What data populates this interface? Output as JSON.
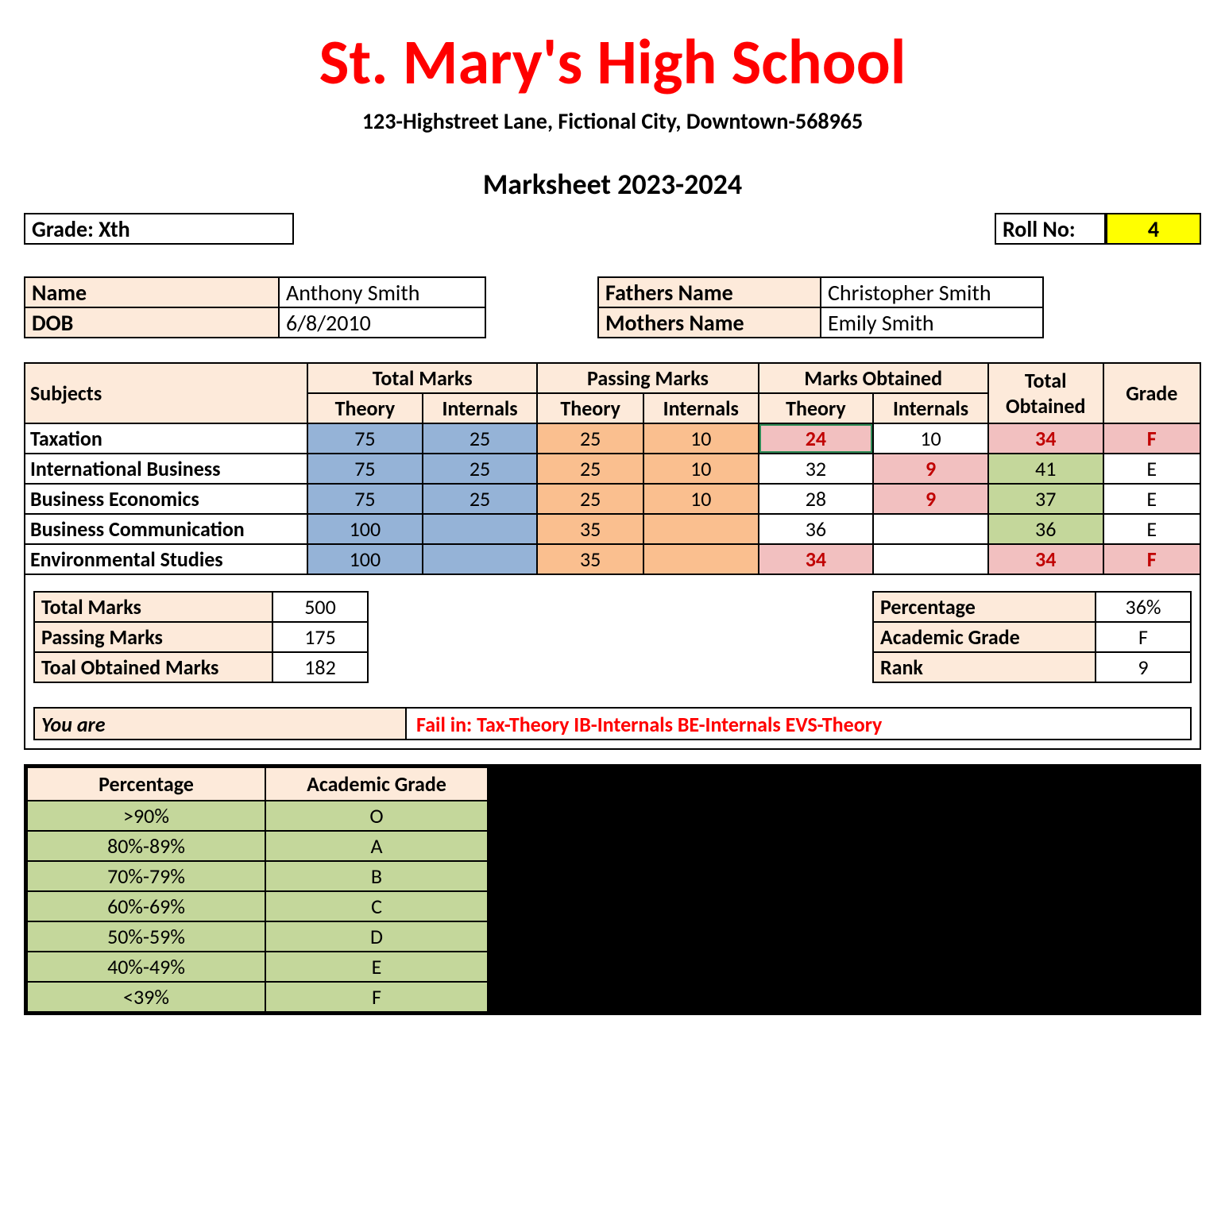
{
  "header": {
    "school": "St. Mary's High School",
    "address": "123-Highstreet Lane, Fictional City, Downtown-568965",
    "title": "Marksheet 2023-2024"
  },
  "top": {
    "grade_label": "Grade: Xth",
    "roll_label": "Roll No:",
    "roll_value": "4"
  },
  "student": {
    "name_label": "Name",
    "name": "Anthony Smith",
    "dob_label": "DOB",
    "dob": "6/8/2010",
    "father_label": "Fathers Name",
    "father": "Christopher Smith",
    "mother_label": "Mothers Name",
    "mother": "Emily Smith"
  },
  "marks_header": {
    "subjects": "Subjects",
    "total_marks": "Total Marks",
    "passing_marks": "Passing Marks",
    "marks_obtained": "Marks Obtained",
    "total_obtained": "Total Obtained",
    "grade": "Grade",
    "theory": "Theory",
    "internals": "Internals"
  },
  "subjects": [
    {
      "name": "Taxation",
      "tm_t": "75",
      "tm_i": "25",
      "pm_t": "25",
      "pm_i": "10",
      "mo_t": "24",
      "mo_i": "10",
      "tot": "34",
      "grade": "F",
      "mo_t_fail": true,
      "mo_i_fail": false,
      "tot_green": false,
      "grade_fail": true,
      "sel": true
    },
    {
      "name": "International Business",
      "tm_t": "75",
      "tm_i": "25",
      "pm_t": "25",
      "pm_i": "10",
      "mo_t": "32",
      "mo_i": "9",
      "tot": "41",
      "grade": "E",
      "mo_t_fail": false,
      "mo_i_fail": true,
      "tot_green": true,
      "grade_fail": false
    },
    {
      "name": "Business Economics",
      "tm_t": "75",
      "tm_i": "25",
      "pm_t": "25",
      "pm_i": "10",
      "mo_t": "28",
      "mo_i": "9",
      "tot": "37",
      "grade": "E",
      "mo_t_fail": false,
      "mo_i_fail": true,
      "tot_green": true,
      "grade_fail": false
    },
    {
      "name": "Business Communication",
      "tm_t": "100",
      "tm_i": "",
      "pm_t": "35",
      "pm_i": "",
      "mo_t": "36",
      "mo_i": "",
      "tot": "36",
      "grade": "E",
      "mo_t_fail": false,
      "mo_i_fail": false,
      "tot_green": true,
      "grade_fail": false
    },
    {
      "name": "Environmental Studies",
      "tm_t": "100",
      "tm_i": "",
      "pm_t": "35",
      "pm_i": "",
      "mo_t": "34",
      "mo_i": "",
      "tot": "34",
      "grade": "F",
      "mo_t_fail": true,
      "mo_i_fail": false,
      "tot_green": false,
      "grade_fail": true
    }
  ],
  "summary_left": {
    "total_marks_label": "Total Marks",
    "total_marks": "500",
    "passing_marks_label": "Passing Marks",
    "passing_marks": "175",
    "obtained_label": "Toal Obtained Marks",
    "obtained": "182"
  },
  "summary_right": {
    "pct_label": "Percentage",
    "pct": "36%",
    "grade_label": "Academic  Grade",
    "grade": "F",
    "rank_label": "Rank",
    "rank": "9"
  },
  "youare": {
    "label": "You are",
    "value": "Fail in: Tax-Theory   IB-Internals  BE-Internals  EVS-Theory"
  },
  "legend": {
    "h1": "Percentage",
    "h2": "Academic Grade",
    "rows": [
      {
        "p": ">90%",
        "g": "O"
      },
      {
        "p": "80%-89%",
        "g": "A"
      },
      {
        "p": "70%-79%",
        "g": "B"
      },
      {
        "p": "60%-69%",
        "g": "C"
      },
      {
        "p": "50%-59%",
        "g": "D"
      },
      {
        "p": "40%-49%",
        "g": "E"
      },
      {
        "p": "<39%",
        "g": "F"
      }
    ]
  },
  "chart_data": {
    "type": "table",
    "title": "Marksheet 2023-2024",
    "columns": [
      "Subject",
      "TotalMarks_Theory",
      "TotalMarks_Internals",
      "PassingMarks_Theory",
      "PassingMarks_Internals",
      "Obtained_Theory",
      "Obtained_Internals",
      "Total_Obtained",
      "Grade"
    ],
    "rows": [
      [
        "Taxation",
        75,
        25,
        25,
        10,
        24,
        10,
        34,
        "F"
      ],
      [
        "International Business",
        75,
        25,
        25,
        10,
        32,
        9,
        41,
        "E"
      ],
      [
        "Business Economics",
        75,
        25,
        25,
        10,
        28,
        9,
        37,
        "E"
      ],
      [
        "Business Communication",
        100,
        null,
        35,
        null,
        36,
        null,
        36,
        "E"
      ],
      [
        "Environmental Studies",
        100,
        null,
        35,
        null,
        34,
        null,
        34,
        "F"
      ]
    ],
    "totals": {
      "total_marks": 500,
      "passing_marks": 175,
      "obtained": 182,
      "percentage": 36,
      "academic_grade": "F",
      "rank": 9
    },
    "grade_scale": [
      {
        "range": ">90%",
        "grade": "O"
      },
      {
        "range": "80%-89%",
        "grade": "A"
      },
      {
        "range": "70%-79%",
        "grade": "B"
      },
      {
        "range": "60%-69%",
        "grade": "C"
      },
      {
        "range": "50%-59%",
        "grade": "D"
      },
      {
        "range": "40%-49%",
        "grade": "E"
      },
      {
        "range": "<39%",
        "grade": "F"
      }
    ]
  }
}
